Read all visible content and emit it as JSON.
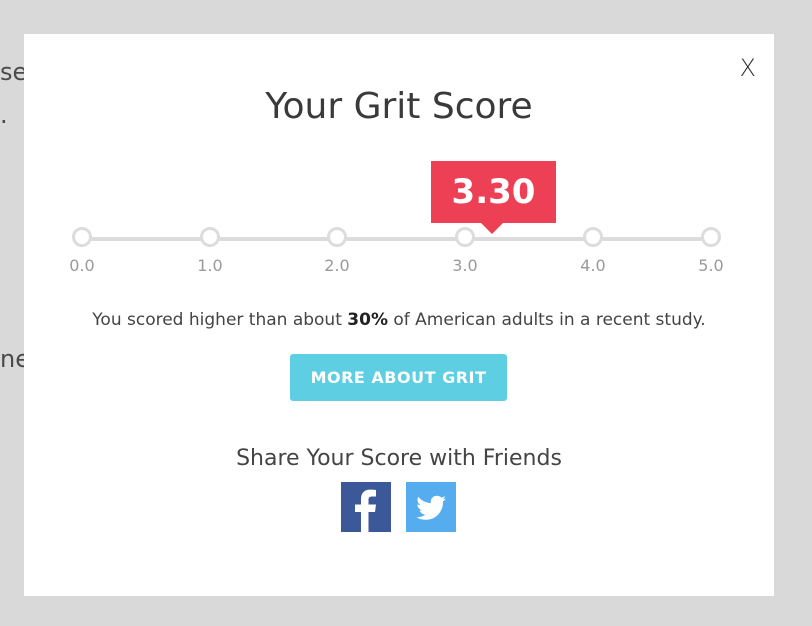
{
  "background": {
    "fragments": [
      "se",
      ".",
      "ne"
    ]
  },
  "modal": {
    "close_label": "X",
    "title": "Your Grit Score",
    "score": "3.30",
    "score_value": 3.3,
    "scale": {
      "min": 0,
      "max": 5,
      "ticks": [
        "0.0",
        "1.0",
        "2.0",
        "3.0",
        "4.0",
        "5.0"
      ]
    },
    "summary": {
      "prefix": "You scored higher than about ",
      "percent": "30%",
      "suffix": " of American adults in a recent study."
    },
    "more_button_label": "MORE ABOUT GRIT",
    "share_title": "Share Your Score with Friends",
    "social": [
      {
        "name": "facebook-icon",
        "color": "#3b5998"
      },
      {
        "name": "twitter-icon",
        "color": "#55acee"
      }
    ]
  },
  "colors": {
    "accent_red": "#ee4054",
    "button_cyan": "#5ecfe2",
    "track_gray": "#dcdcdc"
  }
}
